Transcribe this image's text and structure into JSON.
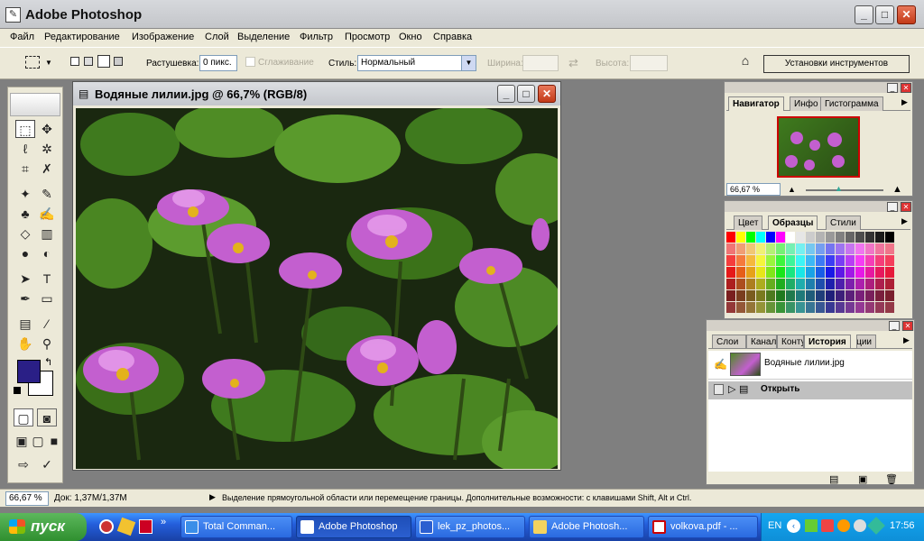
{
  "window": {
    "title": "Adobe Photoshop",
    "min": "_",
    "max": "□",
    "close": "✕"
  },
  "menu": [
    "Файл",
    "Редактирование",
    "Изображение",
    "Слой",
    "Выделение",
    "Фильтр",
    "Просмотр",
    "Окно",
    "Справка"
  ],
  "options": {
    "feather_label": "Растушевка:",
    "feather_value": "0 пикс.",
    "antialias_label": "Сглаживание",
    "style_label": "Стиль:",
    "style_value": "Нормальный",
    "width_label": "Ширина:",
    "height_label": "Высота:",
    "tool_presets": "Установки инструментов"
  },
  "document": {
    "title": "Водяные лилии.jpg @ 66,7% (RGB/8)"
  },
  "navigator": {
    "tabs": [
      "Навигатор",
      "Инфо",
      "Гистограмма"
    ],
    "zoom": "66,67 %"
  },
  "swatches": {
    "tabs": [
      "Цвет",
      "Образцы",
      "Стили"
    ]
  },
  "history": {
    "tabs": [
      "Слои",
      "Каналы",
      "Контуры",
      "История",
      "Операции"
    ],
    "snapshot": "Водяные лилии.jpg",
    "step": "Открыть"
  },
  "status": {
    "zoom": "66,67 %",
    "doc": "Док: 1,37M/1,37M",
    "hint": "Выделение прямоугольной области или перемещение границы. Дополнительные возможности: с клавишами Shift, Alt и Ctrl."
  },
  "taskbar": {
    "start": "пуск",
    "tasks": [
      "Total Comman...",
      "Adobe Photoshop",
      "lek_pz_photos...",
      "Adobe Photosh...",
      "volkova.pdf - ..."
    ],
    "lang": "EN",
    "clock": "17:56"
  },
  "colors": {
    "foreground": "#2a1f86",
    "background": "#ffffff"
  }
}
